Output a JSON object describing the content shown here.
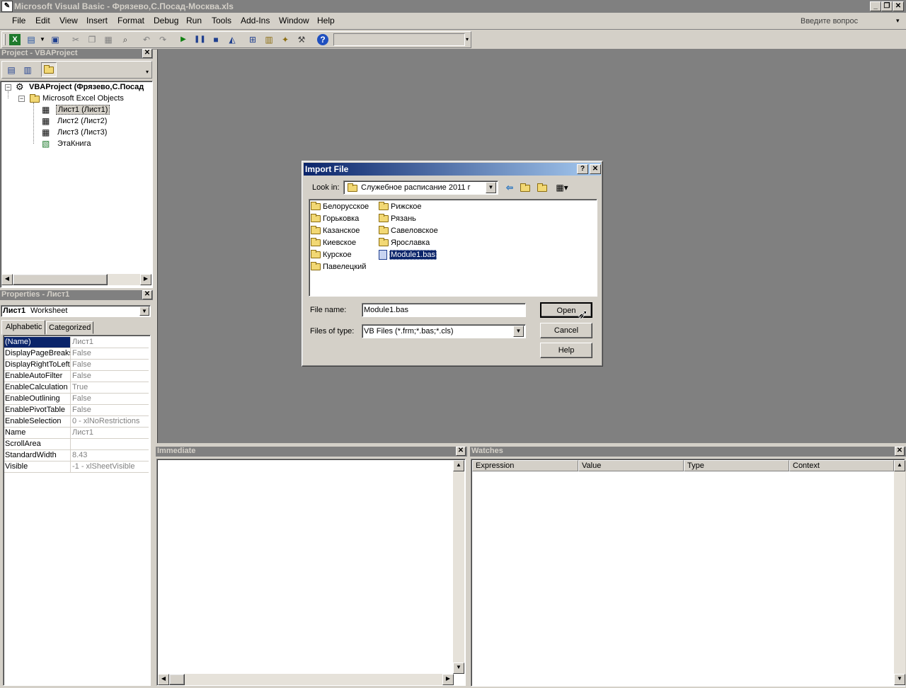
{
  "window": {
    "title": "Microsoft Visual Basic - Фрязево,С.Посад-Москва.xls"
  },
  "menu": {
    "items": [
      {
        "label": "File"
      },
      {
        "label": "Edit"
      },
      {
        "label": "View"
      },
      {
        "label": "Insert"
      },
      {
        "label": "Format"
      },
      {
        "label": "Debug"
      },
      {
        "label": "Run"
      },
      {
        "label": "Tools"
      },
      {
        "label": "Add-Ins"
      },
      {
        "label": "Window"
      },
      {
        "label": "Help"
      }
    ],
    "ask_placeholder": "Введите вопрос"
  },
  "project": {
    "title": "Project - VBAProject",
    "tree": [
      {
        "label": "VBAProject (Фрязево,С.Посад",
        "icon": "vbaproject-icon"
      },
      {
        "label": "Microsoft Excel Objects",
        "icon": "folder-icon"
      },
      {
        "label": "Лист1 (Лист1)",
        "icon": "sheet-icon"
      },
      {
        "label": "Лист2 (Лист2)",
        "icon": "sheet-icon"
      },
      {
        "label": "Лист3 (Лист3)",
        "icon": "sheet-icon"
      },
      {
        "label": "ЭтаКнига",
        "icon": "workbook-icon"
      }
    ]
  },
  "properties": {
    "title": "Properties - Лист1",
    "object_name": "Лист1",
    "object_type": "Worksheet",
    "tabs": [
      {
        "label": "Alphabetic"
      },
      {
        "label": "Categorized"
      }
    ],
    "rows": [
      {
        "name": "(Name)",
        "value": "Лист1"
      },
      {
        "name": "DisplayPageBreaks",
        "value": "False"
      },
      {
        "name": "DisplayRightToLeft",
        "value": "False"
      },
      {
        "name": "EnableAutoFilter",
        "value": "False"
      },
      {
        "name": "EnableCalculation",
        "value": "True"
      },
      {
        "name": "EnableOutlining",
        "value": "False"
      },
      {
        "name": "EnablePivotTable",
        "value": "False"
      },
      {
        "name": "EnableSelection",
        "value": "0 - xlNoRestrictions"
      },
      {
        "name": "Name",
        "value": "Лист1"
      },
      {
        "name": "ScrollArea",
        "value": ""
      },
      {
        "name": "StandardWidth",
        "value": "8.43"
      },
      {
        "name": "Visible",
        "value": "-1 - xlSheetVisible"
      }
    ]
  },
  "immediate": {
    "title": "Immediate"
  },
  "watches": {
    "title": "Watches",
    "columns": [
      {
        "label": "Expression"
      },
      {
        "label": "Value"
      },
      {
        "label": "Type"
      },
      {
        "label": "Context"
      }
    ]
  },
  "dialog": {
    "title": "Import File",
    "look_in_label": "Look in:",
    "look_in_value": "Служебное расписание 2011 г",
    "files": [
      {
        "name": "Белорусское",
        "type": "folder"
      },
      {
        "name": "Горьковка",
        "type": "folder"
      },
      {
        "name": "Казанское",
        "type": "folder"
      },
      {
        "name": "Киевское",
        "type": "folder"
      },
      {
        "name": "Курское",
        "type": "folder"
      },
      {
        "name": "Павелецкий",
        "type": "folder"
      },
      {
        "name": "Рижское",
        "type": "folder"
      },
      {
        "name": "Рязань",
        "type": "folder"
      },
      {
        "name": "Савеловское",
        "type": "folder"
      },
      {
        "name": "Ярославка",
        "type": "folder"
      },
      {
        "name": "Module1.bas",
        "type": "file",
        "selected": true
      }
    ],
    "file_name_label": "File name:",
    "file_name_value": "Module1.bas",
    "file_type_label": "Files of type:",
    "file_type_value": "VB Files (*.frm;*.bas;*.cls)",
    "buttons": {
      "open": "Open",
      "cancel": "Cancel",
      "help": "Help"
    }
  }
}
